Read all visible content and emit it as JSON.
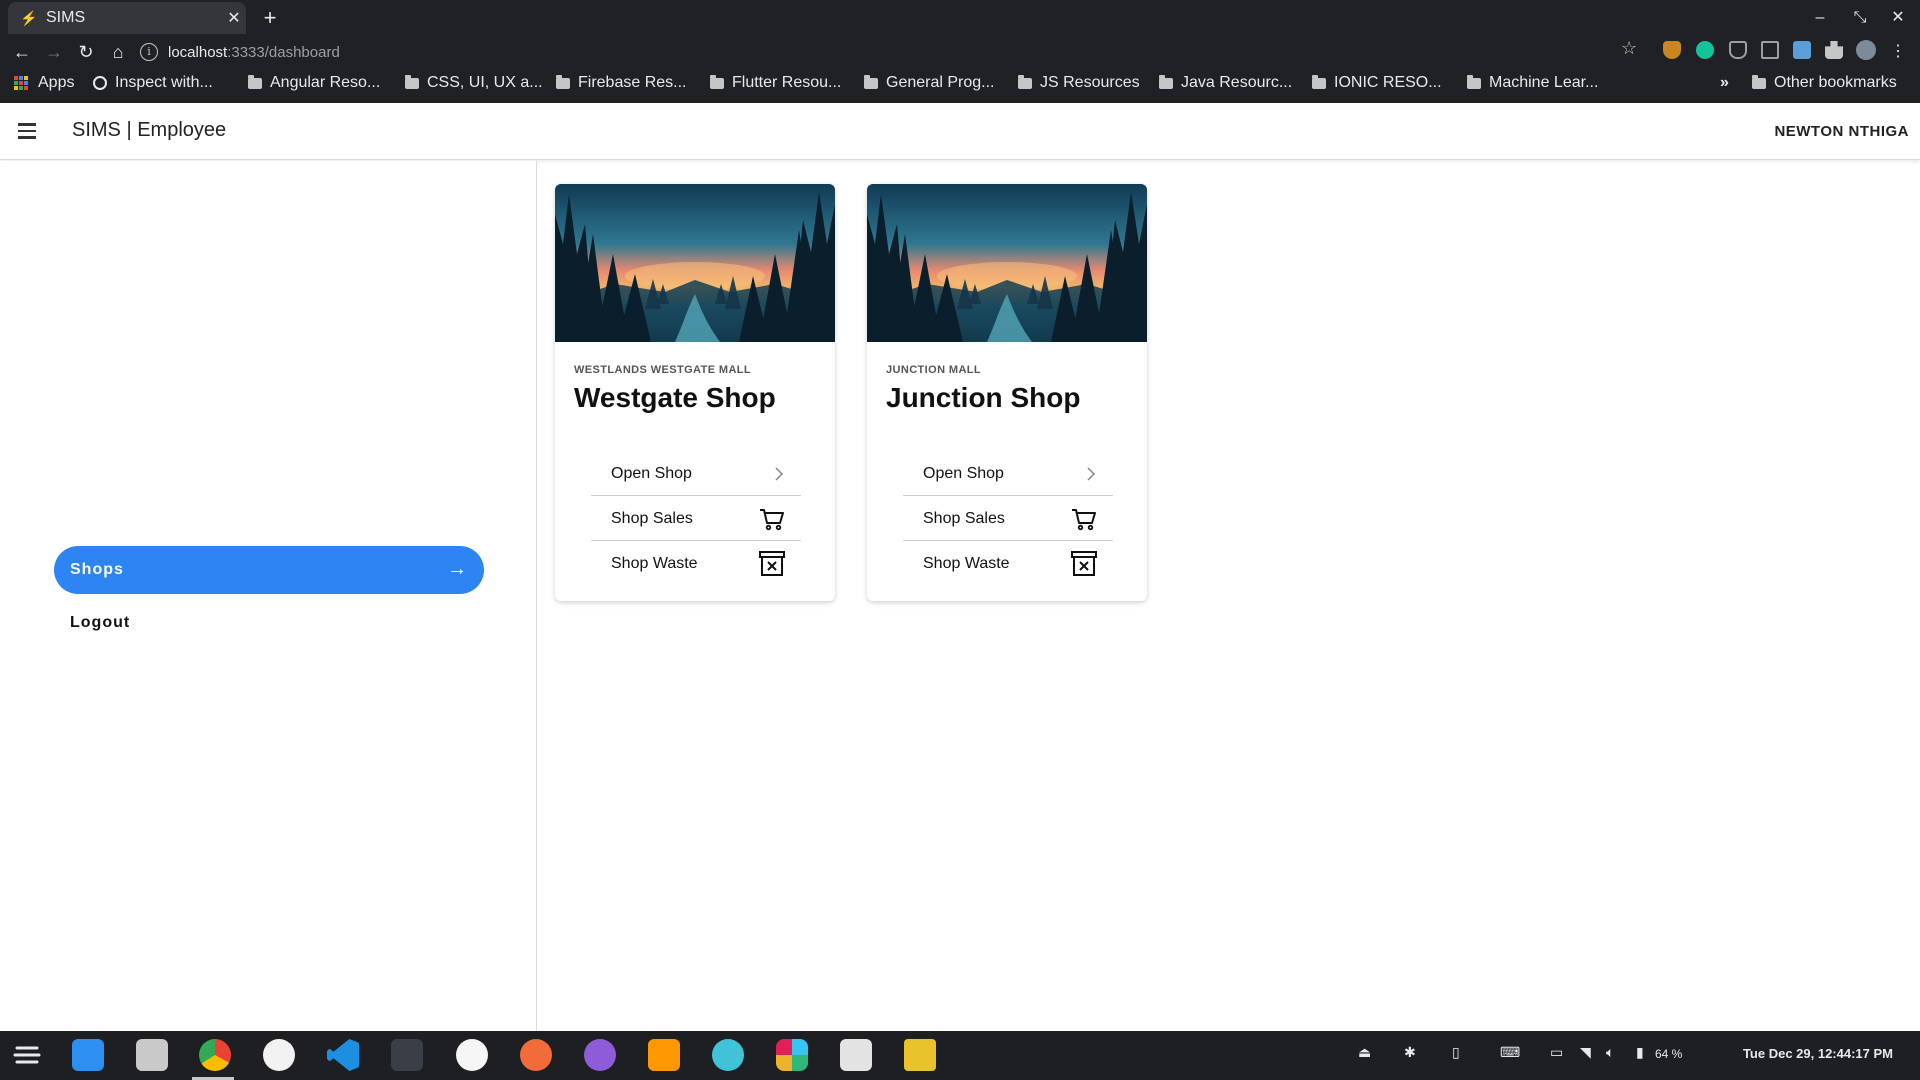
{
  "browser": {
    "tab_title": "SIMS",
    "url_host": "localhost",
    "url_path": ":3333/dashboard",
    "bookmarks": [
      {
        "label": "Apps",
        "icon": "apps-grid-icon"
      },
      {
        "label": "Inspect with...",
        "icon": "globe-icon"
      },
      {
        "label": "Angular Reso...",
        "icon": "folder-icon"
      },
      {
        "label": "CSS, UI, UX a...",
        "icon": "folder-icon"
      },
      {
        "label": "Firebase Res...",
        "icon": "folder-icon"
      },
      {
        "label": "Flutter Resou...",
        "icon": "folder-icon"
      },
      {
        "label": "General Prog...",
        "icon": "folder-icon"
      },
      {
        "label": "JS Resources",
        "icon": "folder-icon"
      },
      {
        "label": "Java Resourc...",
        "icon": "folder-icon"
      },
      {
        "label": "IONIC RESO...",
        "icon": "folder-icon"
      },
      {
        "label": "Machine Lear...",
        "icon": "folder-icon"
      }
    ],
    "overflow_label": "»",
    "other_bookmarks": "Other bookmarks"
  },
  "app": {
    "title": "SIMS | Employee",
    "user": "NEWTON NTHIGA"
  },
  "sidebar": {
    "items": [
      {
        "label": "Shops",
        "active": true
      },
      {
        "label": "Logout",
        "active": false
      }
    ]
  },
  "shops": [
    {
      "location": "WESTLANDS WESTGATE MALL",
      "name": "Westgate Shop",
      "actions": [
        {
          "label": "Open Shop",
          "icon": "chevron-right-icon"
        },
        {
          "label": "Shop Sales",
          "icon": "cart-icon"
        },
        {
          "label": "Shop Waste",
          "icon": "waste-bin-icon"
        }
      ]
    },
    {
      "location": "JUNCTION MALL",
      "name": "Junction Shop",
      "actions": [
        {
          "label": "Open Shop",
          "icon": "chevron-right-icon"
        },
        {
          "label": "Shop Sales",
          "icon": "cart-icon"
        },
        {
          "label": "Shop Waste",
          "icon": "waste-bin-icon"
        }
      ]
    }
  ],
  "taskbar": {
    "apps": [
      "zorin-menu-icon",
      "software-store-icon",
      "files-icon",
      "chrome-icon",
      "wps-writer-icon",
      "vscode-icon",
      "terminal-icon",
      "mongodb-compass-icon",
      "postman-icon",
      "github-desktop-icon",
      "sublime-text-icon",
      "mail-icon",
      "slack-icon",
      "notes-icon",
      "rhythmbox-icon"
    ],
    "battery": "64 %",
    "clock": "Tue Dec 29, 12:44:17 PM"
  },
  "colors": {
    "accent": "#2d84f3",
    "browser_bg": "#202124",
    "taskbar_bg": "#1d1f22"
  }
}
